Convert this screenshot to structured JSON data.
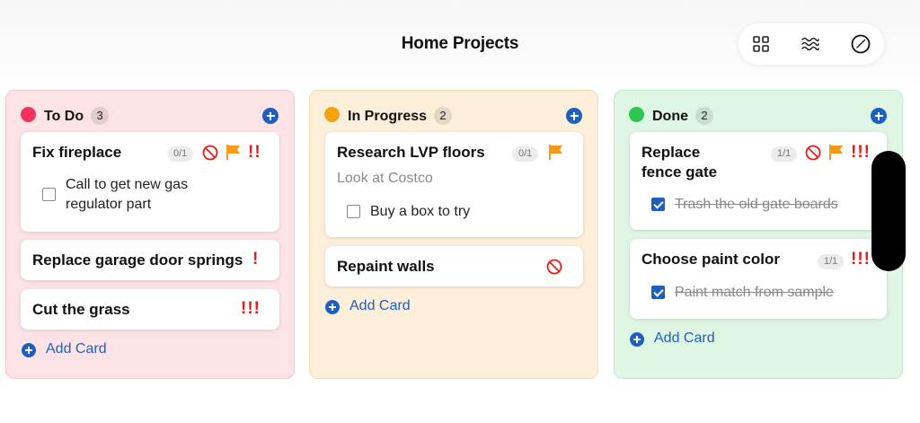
{
  "header": {
    "title": "Home Projects"
  },
  "toolbar": {
    "icons": [
      "grid-view-icon",
      "waves-filter-icon",
      "compass-icon"
    ]
  },
  "colors": {
    "todo_bg": "#fde3e6",
    "todo_border": "#f5c6cc",
    "todo_dot": "#f0335a",
    "inprogress_bg": "#fdefd9",
    "inprogress_border": "#f3dcb6",
    "inprogress_dot": "#f5a20f",
    "done_bg": "#e0f6e4",
    "done_border": "#c1e9c9",
    "done_dot": "#2fc552",
    "accent": "#1f5fbf",
    "priority": "#e0201a",
    "flag": "#f59a1b"
  },
  "columns": [
    {
      "title": "To Do",
      "count": "3",
      "add_label": "Add Card",
      "cards": [
        {
          "title": "Fix fireplace",
          "progress": "0/1",
          "priority": "!!",
          "blocked": true,
          "flagged": true,
          "checklist": [
            {
              "text_line1": "Call to get new gas",
              "text_line2": "regulator part",
              "checked": false
            }
          ]
        },
        {
          "title": "Replace garage door springs",
          "priority": "!"
        },
        {
          "title": "Cut the grass",
          "priority": "!!!"
        }
      ]
    },
    {
      "title": "In Progress",
      "count": "2",
      "add_label": "Add Card",
      "cards": [
        {
          "title": "Research LVP floors",
          "progress": "0/1",
          "flagged": true,
          "note": "Look at Costco",
          "checklist": [
            {
              "text": "Buy a box to try",
              "checked": false
            }
          ]
        },
        {
          "title": "Repaint walls",
          "blocked": true
        }
      ]
    },
    {
      "title": "Done",
      "count": "2",
      "add_label": "Add Card",
      "cards": [
        {
          "title_line1": "Replace",
          "title_line2": "fence gate",
          "progress": "1/1",
          "priority": "!!!",
          "blocked": true,
          "flagged": true,
          "checklist": [
            {
              "text": "Trash the old gate boards",
              "checked": true
            }
          ]
        },
        {
          "title": "Choose paint color",
          "progress": "1/1",
          "priority": "!!!",
          "checklist": [
            {
              "text": "Paint match from sample",
              "checked": true
            }
          ]
        }
      ]
    }
  ]
}
